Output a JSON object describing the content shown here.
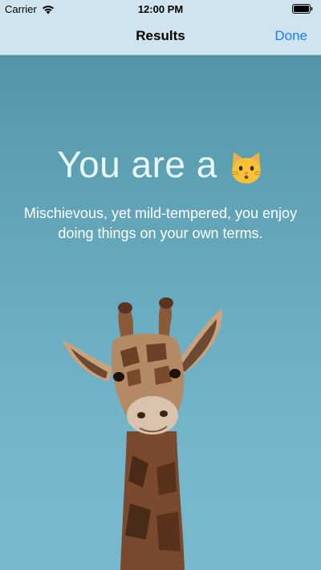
{
  "status_bar": {
    "carrier": "Carrier",
    "time": "12:00 PM",
    "icons": [
      "wifi-icon",
      "battery-icon"
    ]
  },
  "nav": {
    "title": "Results",
    "done_label": "Done"
  },
  "result": {
    "headline": "You are a",
    "emoji": "cat-face-icon",
    "description_line1": "Mischievous, yet mild-tempered, you enjoy",
    "description_line2": "doing things on your own terms."
  },
  "colors": {
    "accent": "#1a7cf5",
    "background_top": "#4e8fa2",
    "background_bottom": "#78b9cd",
    "headline": "#e8fbff"
  }
}
